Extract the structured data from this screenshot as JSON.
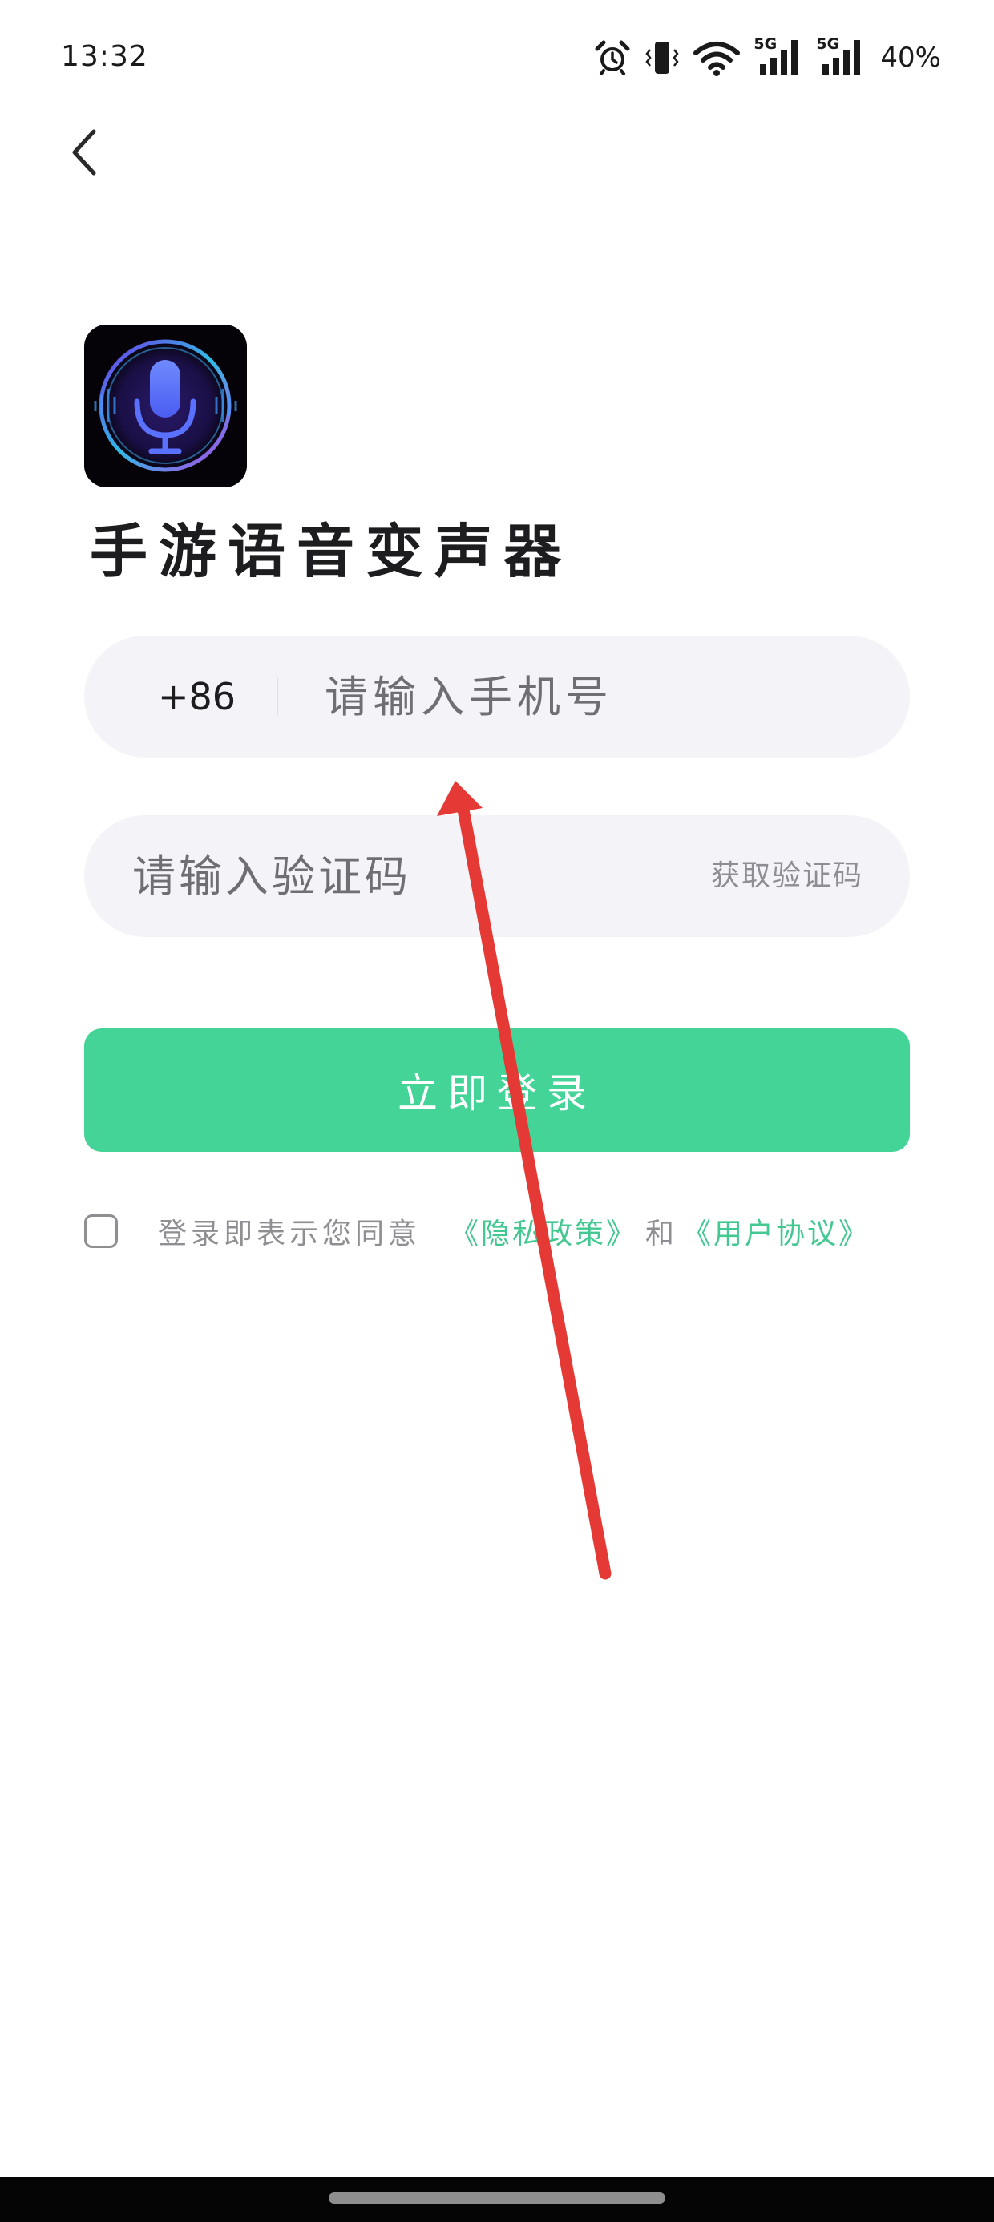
{
  "status_bar": {
    "time": "13:32",
    "network_label_1": "5G",
    "network_label_2": "5G",
    "battery": "40%",
    "icons": [
      "alarm-icon",
      "vibrate-icon",
      "wifi-icon",
      "signal-icon",
      "signal-icon"
    ]
  },
  "nav": {
    "back_icon": "chevron-left-icon"
  },
  "app": {
    "title": "手游语音变声器",
    "logo_icon": "microphone-icon"
  },
  "login_form": {
    "country_code": "+86",
    "phone_placeholder": "请输入手机号",
    "phone_value": "",
    "code_placeholder": "请输入验证码",
    "code_value": "",
    "get_code_label": "获取验证码",
    "login_label": "立即登录"
  },
  "agreement": {
    "checked": false,
    "text": "登录即表示您同意",
    "privacy_link": "《隐私政策》",
    "and_text": "和",
    "terms_link": "《用户协议》"
  },
  "colors": {
    "accent": "#44d498",
    "link": "#44c891",
    "field_bg": "#f4f4f8",
    "annotation_arrow": "#e53935"
  }
}
